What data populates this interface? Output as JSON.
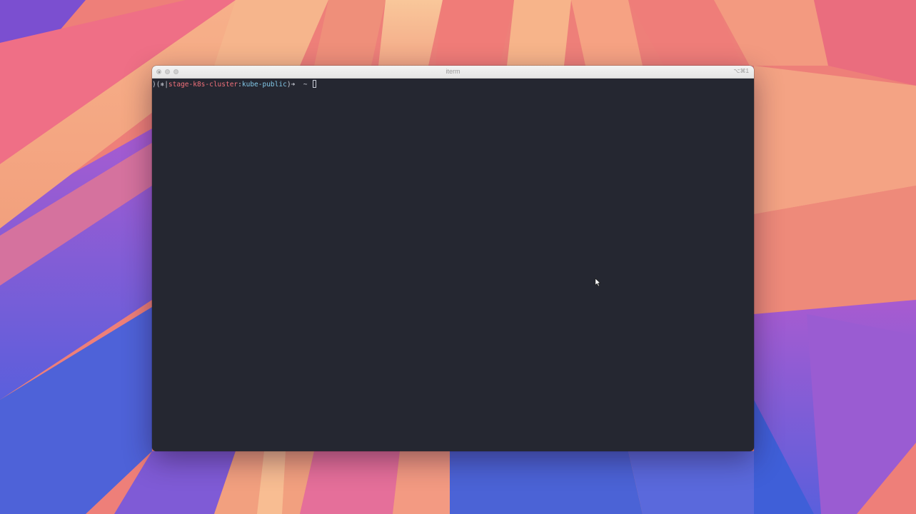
{
  "window": {
    "title": "iterm",
    "shortcut": "⌥⌘1"
  },
  "terminal": {
    "prompt": {
      "prefix": ")(",
      "symbol": "⎈",
      "separator": "|",
      "cluster": "stage-k8s-cluster",
      "colon": ":",
      "namespace": "kube-public",
      "close": ")",
      "arrow": "➜",
      "dir": "  ~ "
    }
  },
  "colors": {
    "terminal_bg": "#252731",
    "cluster_text": "#f0707a",
    "namespace_text": "#83c8e8",
    "titlebar_bg": "#ececec"
  }
}
